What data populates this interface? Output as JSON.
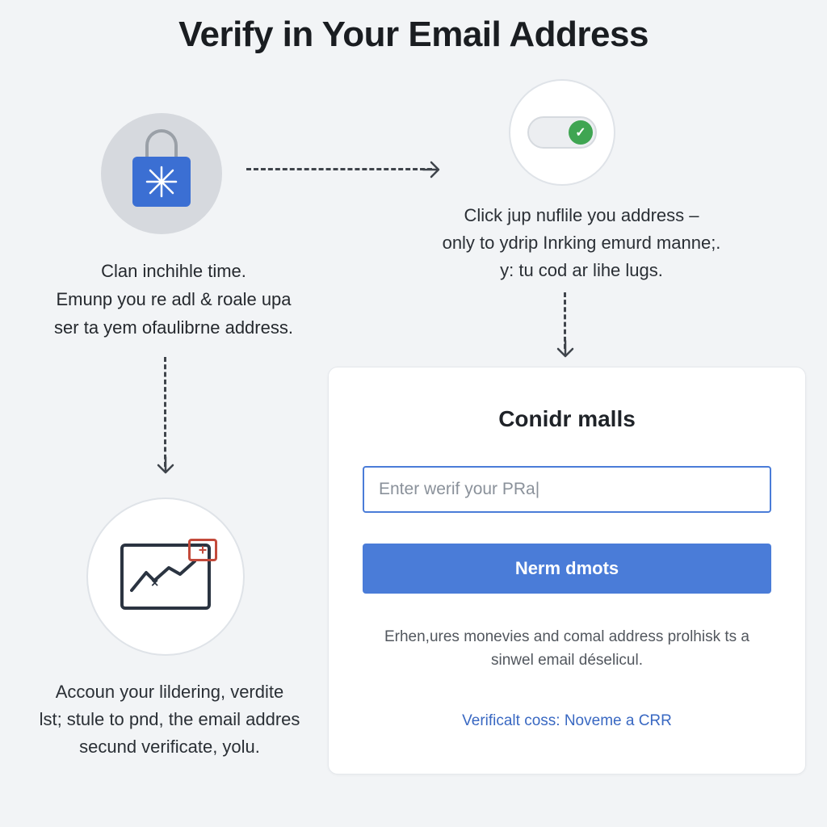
{
  "title": "Verify in Your Email Address",
  "step1": {
    "text": "Clan inchihle time.\nEmunp you re adl & roale upa\nser ta yem ofaulibrne address."
  },
  "step2": {
    "text": "Click jup nuflile you address –\nonly to ydrip Inrking emurd manne;.\ny: tu cod ar lihe lugs."
  },
  "step3": {
    "text": "Accoun your lildering, verdite\nlst; stule to pnd, the email addres\nsecund verificate, yolu."
  },
  "card": {
    "heading": "Conidr malls",
    "placeholder": "Enter werif your PRa|",
    "button": "Nerm dmots",
    "hint": "Erhen,ures monevies and comal address prolhisk ts a\nsinwel email déselicul.",
    "link": "Verificalt coss: Noveme a CRR"
  },
  "icons": {
    "lock": "lock-icon",
    "toggle": "toggle-on-icon",
    "analytics": "analytics-card-icon"
  }
}
